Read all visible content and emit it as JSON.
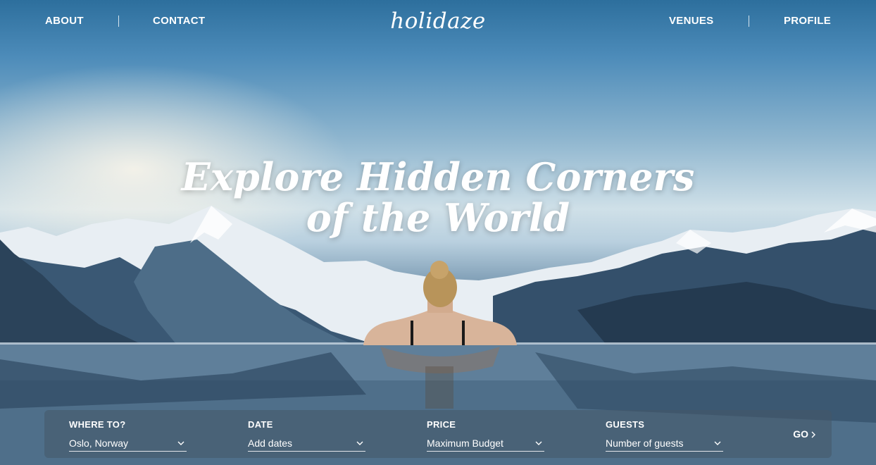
{
  "nav": {
    "left": [
      "ABOUT",
      "CONTACT"
    ],
    "right": [
      "VENUES",
      "PROFILE"
    ],
    "logo": "holidaze"
  },
  "hero": {
    "headline_line1": "Explore Hidden Corners",
    "headline_line2": "of the World"
  },
  "search": {
    "fields": [
      {
        "label": "WHERE TO?",
        "value": "Oslo, Norway"
      },
      {
        "label": "DATE",
        "value": "Add dates"
      },
      {
        "label": "PRICE",
        "value": "Maximum Budget"
      },
      {
        "label": "GUESTS",
        "value": "Number of guests"
      }
    ],
    "go_label": "GO",
    "chevron_icon": "chevron-down-icon",
    "go_icon": "chevron-right-icon"
  },
  "colors": {
    "text": "#ffffff",
    "search_bg": "#465868"
  }
}
